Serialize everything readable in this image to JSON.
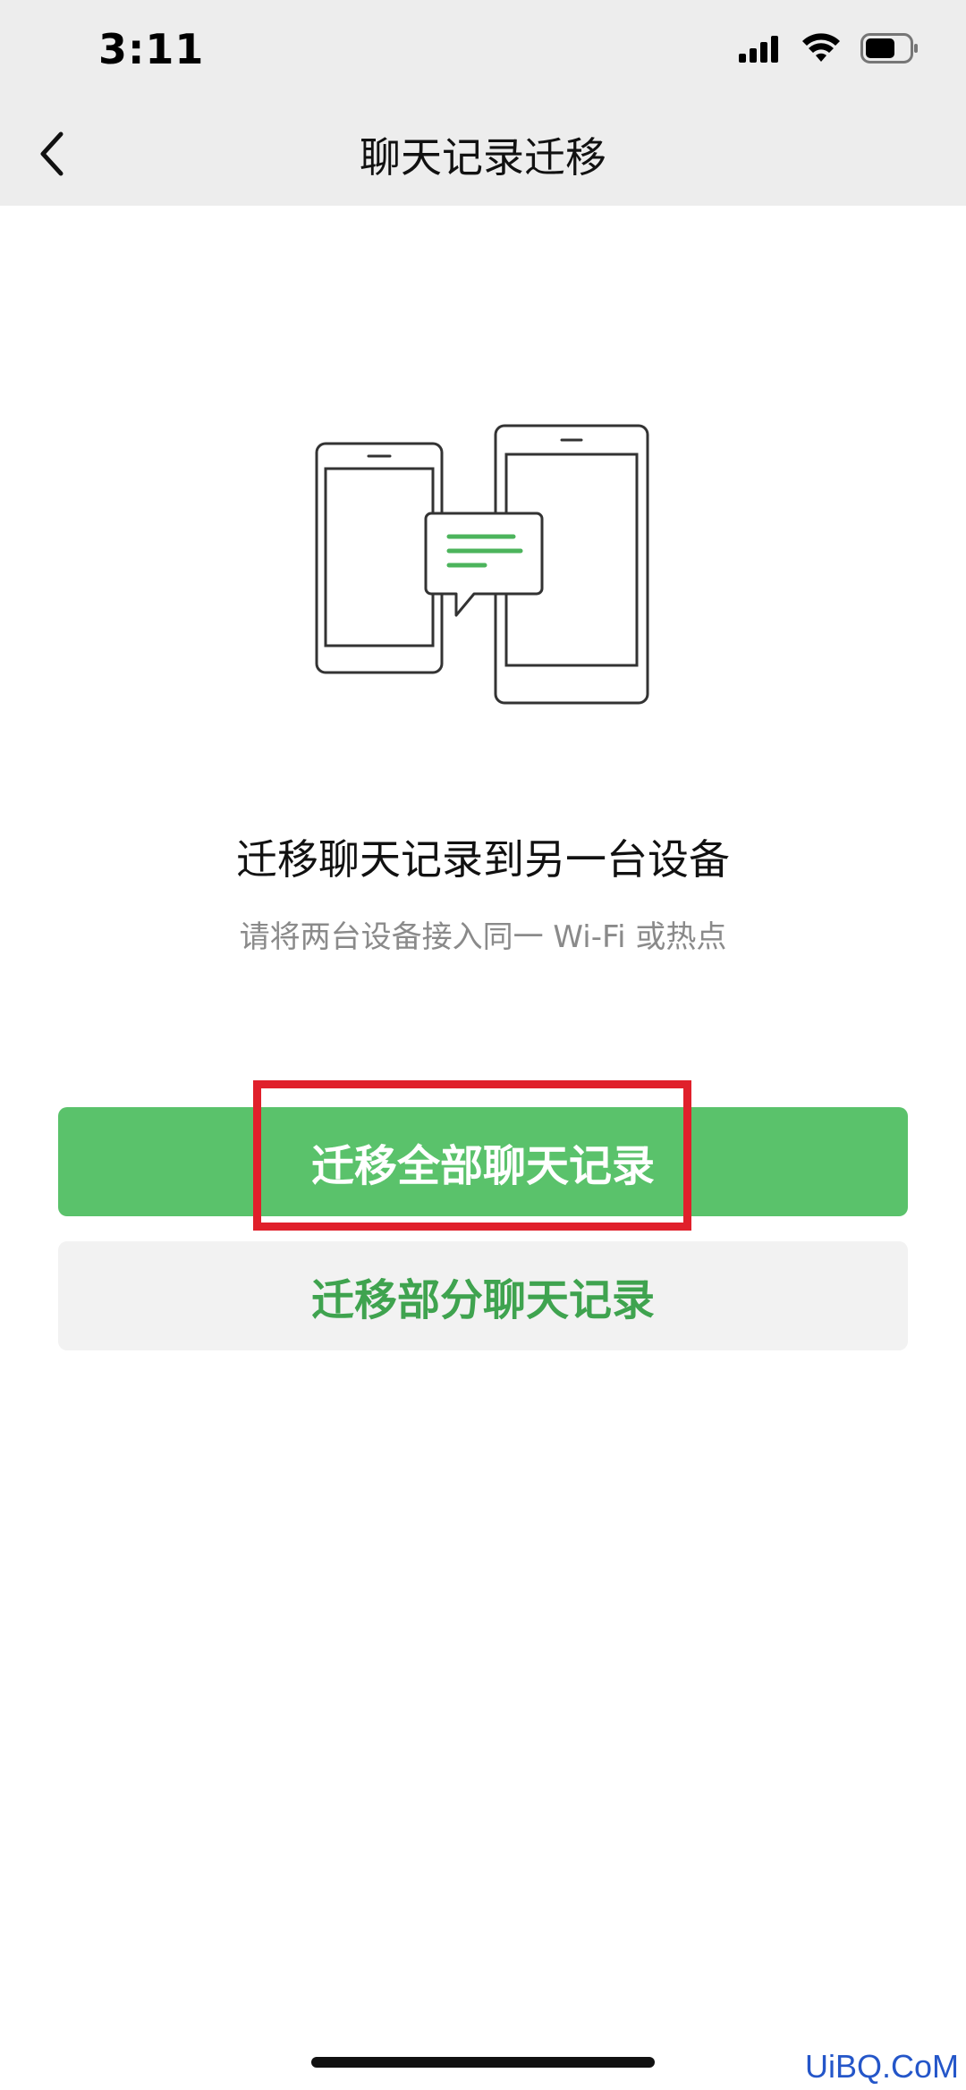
{
  "status_bar": {
    "time": "3:11",
    "icons": [
      "signal-icon",
      "wifi-icon",
      "battery-icon"
    ]
  },
  "nav": {
    "title": "聊天记录迁移",
    "back_icon": "chevron-left-icon"
  },
  "content": {
    "illustration_icon": "phones-transfer-icon",
    "title": "迁移聊天记录到另一台设备",
    "subtitle": "请将两台设备接入同一 Wi-Fi 或热点"
  },
  "actions": {
    "migrate_all_label": "迁移全部聊天记录",
    "migrate_partial_label": "迁移部分聊天记录"
  },
  "watermark": "UiBQ.CoM",
  "colors": {
    "accent": "#5ac26b",
    "accent_text": "#3fa34f",
    "highlight": "#e0202b",
    "nav_bg": "#ededed"
  }
}
